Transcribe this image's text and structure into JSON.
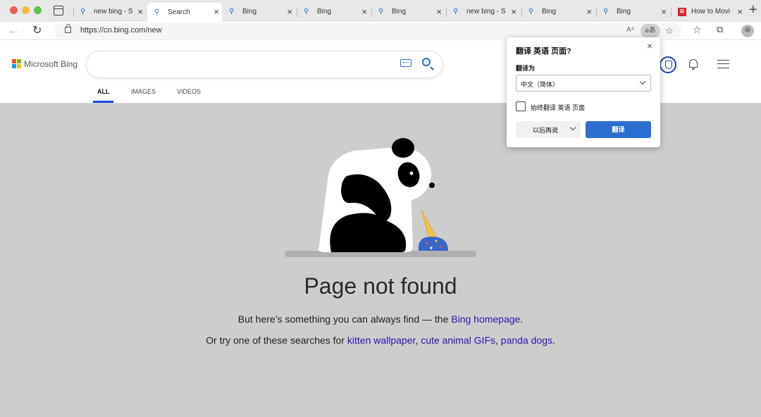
{
  "browser": {
    "tabs": [
      {
        "title": "new bing - S",
        "icon": "bing-search-icon"
      },
      {
        "title": "Search",
        "icon": "bing-search-icon",
        "active": true
      },
      {
        "title": "Bing",
        "icon": "bing-search-icon"
      },
      {
        "title": "Bing",
        "icon": "bing-search-icon"
      },
      {
        "title": "Bing",
        "icon": "bing-search-icon"
      },
      {
        "title": "new bing - S",
        "icon": "bing-search-icon"
      },
      {
        "title": "Bing",
        "icon": "bing-search-icon"
      },
      {
        "title": "Bing",
        "icon": "bing-search-icon"
      },
      {
        "title": "How to Movi",
        "icon": "red-favicon",
        "favicon_text": "R"
      }
    ],
    "address": {
      "url": "https://cn.bing.com/new"
    },
    "toolbar_icons": {
      "read_aloud": "A⁴",
      "translate": "əあ"
    }
  },
  "bing": {
    "brand": "Microsoft Bing",
    "scopes": [
      "ALL",
      "IMAGES",
      "VIDEOS"
    ],
    "active_scope": "ALL",
    "logo_colors": [
      "#f25022",
      "#7fba00",
      "#00a4ef",
      "#ffb900"
    ]
  },
  "main": {
    "title": "Page not found",
    "line1_prefix": "But here’s something you can always find — the ",
    "line1_link": "Bing homepage",
    "line1_suffix": ".",
    "line2_prefix": "Or try one of these searches for ",
    "links": [
      "kitten wallpaper",
      "cute animal GIFs",
      "panda dogs"
    ],
    "line2_suffix": "."
  },
  "translate_popup": {
    "title": "翻译 英语 页面?",
    "label": "翻译为",
    "selected_language": "中文（简体）",
    "checkbox_label": "始终翻译 英语 页面",
    "later_button": "以后再说",
    "translate_button": "翻译"
  },
  "colors": {
    "accent": "#2a6fcf",
    "link": "#2a18a8",
    "scope_underline": "#174ae4",
    "page_bg": "#cdcdcd"
  }
}
